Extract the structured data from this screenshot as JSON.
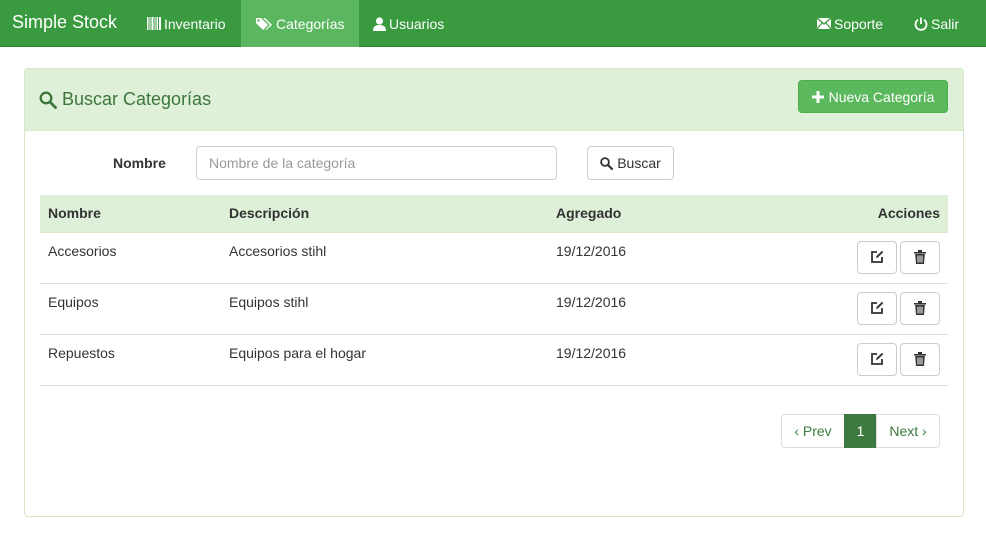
{
  "navbar": {
    "brand": "Simple Stock",
    "items": [
      {
        "label": "Inventario",
        "icon": "barcode-icon"
      },
      {
        "label": "Categorías",
        "icon": "tags-icon"
      },
      {
        "label": "Usuarios",
        "icon": "user-icon"
      }
    ],
    "right_items": [
      {
        "label": "Soporte",
        "icon": "envelope-icon"
      },
      {
        "label": "Salir",
        "icon": "power-icon"
      }
    ]
  },
  "panel": {
    "title": "Buscar Categorías",
    "new_button": "Nueva Categoría"
  },
  "search": {
    "label": "Nombre",
    "placeholder": "Nombre de la categoría",
    "button": "Buscar"
  },
  "table": {
    "headers": [
      "Nombre",
      "Descripción",
      "Agregado",
      "Acciones"
    ],
    "rows": [
      {
        "nombre": "Accesorios",
        "descripcion": "Accesorios stihl",
        "agregado": "19/12/2016"
      },
      {
        "nombre": "Equipos",
        "descripcion": "Equipos stihl",
        "agregado": "19/12/2016"
      },
      {
        "nombre": "Repuestos",
        "descripcion": "Equipos para el hogar",
        "agregado": "19/12/2016"
      }
    ]
  },
  "pagination": {
    "prev": "‹ Prev",
    "current": "1",
    "next": "Next ›"
  },
  "colors": {
    "navbar": "#3a9a3f",
    "navbar_active": "#5bb75f",
    "panel_heading": "#dff0d8",
    "success_button": "#5cb85c",
    "title_text": "#3c763d"
  }
}
